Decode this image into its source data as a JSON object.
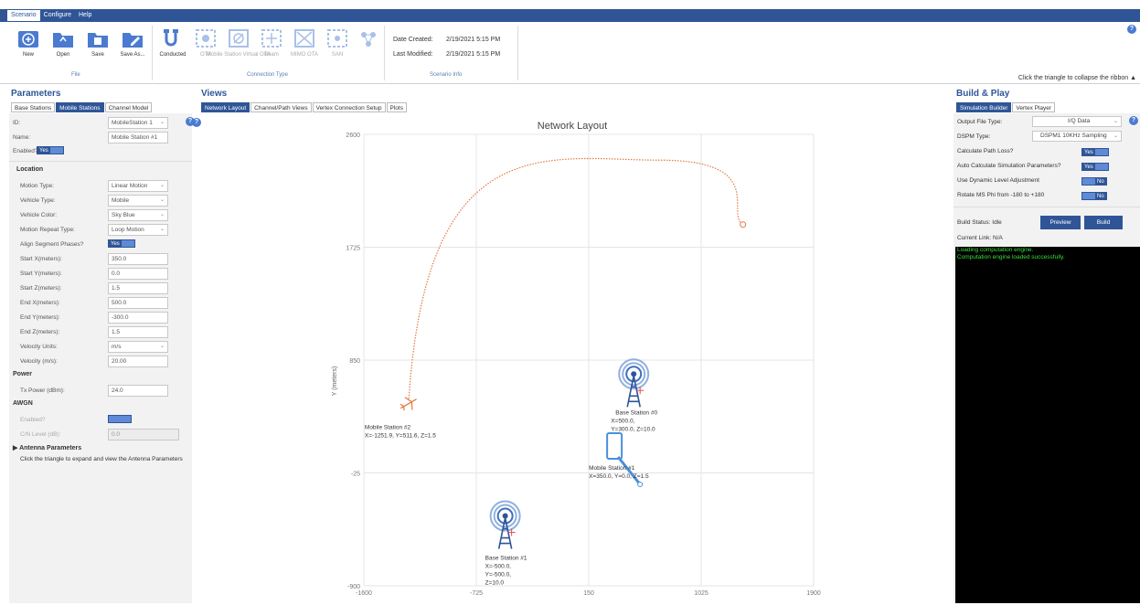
{
  "menu": {
    "items": [
      "Scenario",
      "Configure",
      "Help"
    ],
    "active": "Scenario"
  },
  "ribbon": {
    "file_buttons": [
      "New",
      "Open",
      "Save",
      "Save As..."
    ],
    "file_group": "File",
    "connection_buttons": [
      "Conducted",
      "OTA",
      "Mobile Station Virtual OTA",
      "Beam",
      "MIMO OTA",
      "SAN"
    ],
    "connection_group": "Connection Type",
    "date_created_label": "Date Created:",
    "date_created": "2/19/2021 5:15 PM",
    "last_modified_label": "Last Modified:",
    "last_modified": "2/19/2021 5:15 PM",
    "info_group": "Scenario Info",
    "collapse_hint": "Click the triangle to collapse the ribbon ▲"
  },
  "parameters": {
    "title": "Parameters",
    "tabs": [
      "Base Stations",
      "Mobile Stations",
      "Channel Model"
    ],
    "active_tab": "Mobile Stations",
    "id_label": "ID:",
    "id_value": "MobileStation 1",
    "name_label": "Name:",
    "name_value": "Mobile Station #1",
    "enabled_label": "Enabled?",
    "yes": "Yes",
    "location_title": "Location",
    "motion_type_label": "Motion Type:",
    "motion_type": "Linear Motion",
    "vehicle_type_label": "Vehicle Type:",
    "vehicle_type": "Mobile",
    "vehicle_color_label": "Vehicle Color:",
    "vehicle_color": "Sky Blue",
    "motion_repeat_label": "Motion Repeat Type:",
    "motion_repeat": "Loop Motion",
    "align_label": "Align Segment Phases?",
    "start_x_label": "Start X(meters):",
    "start_x": "350.0",
    "start_y_label": "Start Y(meters):",
    "start_y": "0.0",
    "start_z_label": "Start Z(meters):",
    "start_z": "1.5",
    "end_x_label": "End X(meters):",
    "end_x": "500.0",
    "end_y_label": "End Y(meters):",
    "end_y": "-300.0",
    "end_z_label": "End Z(meters):",
    "end_z": "1.5",
    "velocity_units_label": "Velocity Units:",
    "velocity_units": "m/s",
    "velocity_label": "Velocity (m/s):",
    "velocity": "20.00",
    "power_title": "Power",
    "tx_power_label": "Tx Power (dBm):",
    "tx_power": "24.0",
    "awgn_title": "AWGN",
    "awgn_enabled_label": "Enabled?",
    "cn_label": "C/N Level (dB):",
    "cn_value": "0.0",
    "antenna_title": "Antenna Parameters",
    "antenna_hint": "Click the triangle to expand and view the Antenna Parameters"
  },
  "views": {
    "title": "Views",
    "tabs": [
      "Network Layout",
      "Channel/Path Views",
      "Vertex Connection Setup",
      "Plots"
    ],
    "active_tab": "Network Layout"
  },
  "chart_data": {
    "type": "scatter",
    "title": "Network Layout",
    "ylabel": "Y (meters)",
    "xlim": [
      -1600,
      1900
    ],
    "ylim": [
      -900,
      2600
    ],
    "xticks": [
      "-1600",
      "-725",
      "150",
      "1025",
      "1900"
    ],
    "yticks": [
      "2600",
      "1725",
      "850",
      "-25",
      "-900"
    ],
    "trajectory": {
      "start": [
        -1250,
        550
      ],
      "apex": [
        700,
        2400
      ],
      "end": [
        1350,
        1900
      ]
    },
    "points": [
      {
        "label": "Mobile Station #2",
        "detail": "X=-1251.9, Y=511.6, Z=1.5",
        "x": -1252,
        "y": 512,
        "kind": "plane"
      },
      {
        "label": "Base Station #0",
        "detail_1": "X=500.0,",
        "detail_2": "Y=300.0, Z=10.0",
        "x": 500,
        "y": 600,
        "kind": "tower"
      },
      {
        "label": "Mobile Station #1",
        "detail": "X=350.0, Y=0.0, Z=1.5",
        "x": 350,
        "y": 0,
        "kind": "phone"
      },
      {
        "label": "Base Station #1",
        "detail_1": "X=-500.0,",
        "detail_2": "Y=-500.0,",
        "detail_3": "Z=10.0",
        "x": -500,
        "y": -500,
        "kind": "tower"
      }
    ]
  },
  "build": {
    "title": "Build & Play",
    "tabs": [
      "Simulation Builder",
      "Vertex Player"
    ],
    "active_tab": "Simulation Builder",
    "output_type_label": "Output File Type:",
    "output_type": "I/Q Data",
    "dspm_label": "DSPM Type:",
    "dspm": "DSPM1 10KHz Sampling",
    "calc_path_loss": "Calculate Path Loss?",
    "auto_calc": "Auto Calculate Simulation Parameters?",
    "dynamic_level": "Use Dynamic Level Adjustment",
    "rotate_phi": "Rotate MS Phi from -180 to +180",
    "yes": "Yes",
    "no": "No",
    "build_status": "Build Status:  Idle",
    "preview": "Preview",
    "build": "Build",
    "current_link": "Current Link: N/A",
    "console": [
      "Loading computation engine.",
      "Computation engine loaded successfully."
    ]
  }
}
